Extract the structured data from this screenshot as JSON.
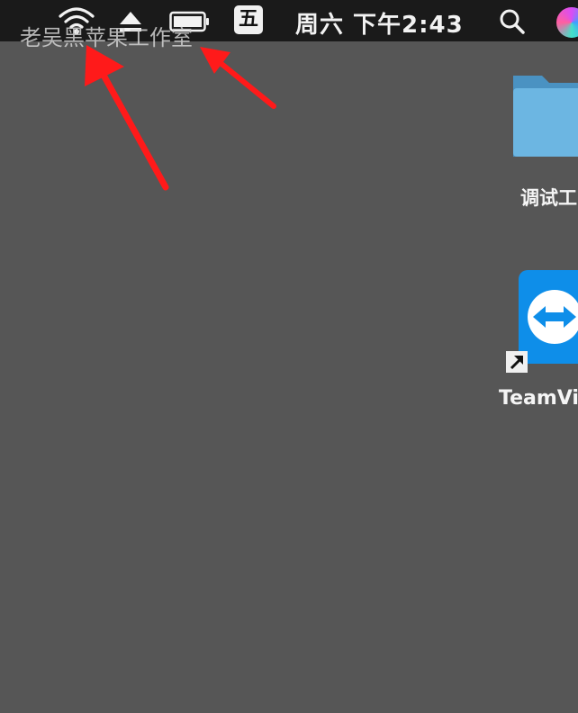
{
  "menubar": {
    "icons": [
      "wifi-icon",
      "eject-icon",
      "battery-icon",
      "search-icon",
      "siri-icon"
    ],
    "input_method": "五",
    "clock": "周六 下午2:43"
  },
  "watermark": "老吴黑苹果工作室",
  "desktop": {
    "items": [
      {
        "label": "调试工",
        "icon": "folder-icon"
      },
      {
        "label": "TeamVi",
        "icon": "teamviewer-icon"
      }
    ]
  },
  "colors": {
    "desktop": "#565656",
    "menubar": "#1a1a1a",
    "annotation_arrow": "#ff1a1a",
    "folder": "#5aa7d6",
    "teamviewer": "#0e8ee9"
  }
}
